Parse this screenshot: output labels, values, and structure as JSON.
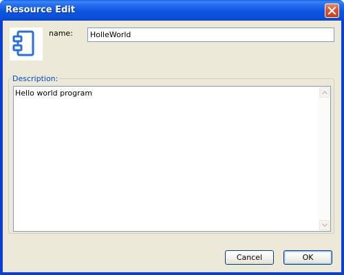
{
  "window": {
    "title": "Resource Edit",
    "close_icon": "close-icon"
  },
  "resource": {
    "icon": "component-icon",
    "name_label": "name:",
    "name_value": "HolleWorld"
  },
  "description": {
    "legend": "Description:",
    "text": "Hello world program"
  },
  "buttons": {
    "cancel_label": "Cancel",
    "ok_label": "OK"
  },
  "colors": {
    "titlebar": "#0a4fd8",
    "client_bg": "#ece9d8",
    "legend_text": "#0046d5",
    "close_button": "#d9542f",
    "icon_blue": "#2a6fd6"
  }
}
